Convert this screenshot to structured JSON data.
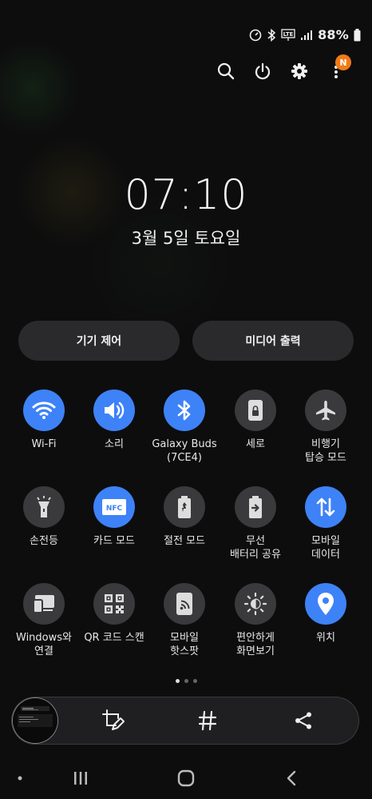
{
  "status_bar": {
    "battery": "88%",
    "icons": [
      "data-saver-icon",
      "bluetooth-icon",
      "volte-icon",
      "signal-icon",
      "battery-icon"
    ]
  },
  "quick_actions": {
    "notification_badge": "N",
    "icons": [
      "search-icon",
      "power-icon",
      "settings-icon",
      "more-icon"
    ]
  },
  "lockscreen": {
    "time": "07:10",
    "date": "3월 5일 토요일"
  },
  "pills": {
    "device_control": "기기 제어",
    "media_output": "미디어 출력"
  },
  "tiles": [
    {
      "label": "Wi-Fi",
      "icon": "wifi-icon",
      "on": true
    },
    {
      "label": "소리",
      "icon": "sound-icon",
      "on": true
    },
    {
      "label": "Galaxy Buds\n(7CE4)",
      "icon": "bluetooth-icon",
      "on": true
    },
    {
      "label": "세로",
      "icon": "portrait-lock-icon",
      "on": false
    },
    {
      "label": "비행기\n탑승 모드",
      "icon": "airplane-icon",
      "on": false
    },
    {
      "label": "손전등",
      "icon": "flashlight-icon",
      "on": false
    },
    {
      "label": "카드 모드",
      "icon": "nfc-card-icon",
      "on": true,
      "badge": "NFC"
    },
    {
      "label": "절전 모드",
      "icon": "battery-saver-icon",
      "on": false
    },
    {
      "label": "무선\n배터리 공유",
      "icon": "wireless-powershare-icon",
      "on": false
    },
    {
      "label": "모바일\n데이터",
      "icon": "mobile-data-icon",
      "on": true
    },
    {
      "label": "Windows와\n연결",
      "icon": "link-to-windows-icon",
      "on": false
    },
    {
      "label": "QR 코드 스캔",
      "icon": "qr-code-icon",
      "on": false
    },
    {
      "label": "모바일\n핫스팟",
      "icon": "hotspot-icon",
      "on": false
    },
    {
      "label": "편안하게\n화면보기",
      "icon": "eye-comfort-icon",
      "on": false
    },
    {
      "label": "위치",
      "icon": "location-icon",
      "on": true
    }
  ],
  "pager": {
    "pages": 3,
    "active": 0
  },
  "screenshot_toolbar": {
    "icons": [
      "screenshot-thumbnail",
      "crop-edit-icon",
      "hashtag-icon",
      "share-icon"
    ]
  },
  "nav_bar": {
    "icons": [
      "indicator-dot",
      "recents-icon",
      "home-icon",
      "back-icon"
    ]
  }
}
